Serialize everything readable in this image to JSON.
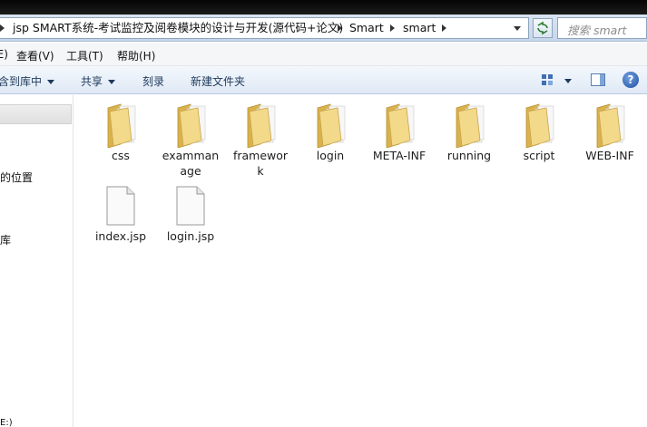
{
  "address_bar": {
    "path": [
      "jsp SMART系统-考试监控及阅卷模块的设计与开发(源代码+论文)",
      "Smart",
      "smart"
    ],
    "search_placeholder": "搜索 smart"
  },
  "menu": {
    "items": [
      "查看(V)",
      "工具(T)",
      "帮助(H)"
    ],
    "partial_first": "(E)"
  },
  "toolbar": {
    "include_library": "含到库中",
    "share": "共享",
    "burn": "刻录",
    "new_folder": "新建文件夹",
    "help_glyph": "?"
  },
  "nav_pane": {
    "items": [
      "的位置",
      "库",
      "E:)"
    ]
  },
  "files": [
    {
      "name": "css",
      "type": "folder"
    },
    {
      "name": "exammanage",
      "type": "folder"
    },
    {
      "name": "framework",
      "type": "folder"
    },
    {
      "name": "login",
      "type": "folder"
    },
    {
      "name": "META-INF",
      "type": "folder"
    },
    {
      "name": "running",
      "type": "folder"
    },
    {
      "name": "script",
      "type": "folder"
    },
    {
      "name": "WEB-INF",
      "type": "folder"
    },
    {
      "name": "index.jsp",
      "type": "file"
    },
    {
      "name": "login.jsp",
      "type": "file"
    }
  ],
  "colors": {
    "folder_body": "#f3d98a",
    "folder_dark": "#d9b24e",
    "command_text": "#1e395b"
  }
}
